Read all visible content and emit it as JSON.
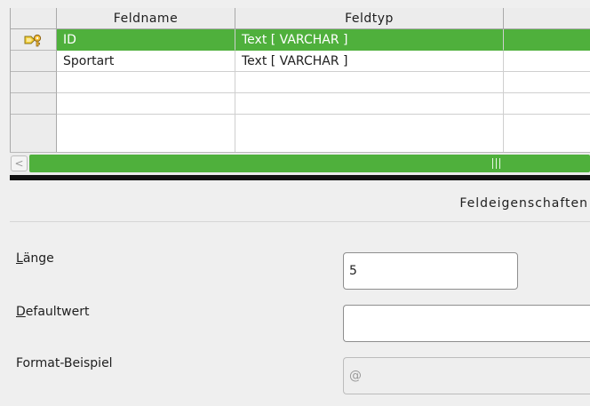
{
  "table": {
    "headers": [
      "",
      "Feldname",
      "Feldtyp",
      ""
    ],
    "rows": [
      {
        "name": "ID",
        "type": "Text [ VARCHAR ]",
        "primary_key": true,
        "selected": true
      },
      {
        "name": "Sportart",
        "type": "Text [ VARCHAR ]",
        "primary_key": false,
        "selected": false
      },
      {
        "name": "",
        "type": "",
        "primary_key": false,
        "selected": false
      },
      {
        "name": "",
        "type": "",
        "primary_key": false,
        "selected": false
      }
    ],
    "row_indicator_icon": "primary-key-icon"
  },
  "scrollbar": {
    "left_arrow": "<",
    "thumb_grip": "grip-lines"
  },
  "properties": {
    "title": "Feldeigenschaften",
    "length": {
      "label_mnemonic": "L",
      "label_rest": "änge",
      "value": "5"
    },
    "default_value": {
      "label_mnemonic": "D",
      "label_rest": "efaultwert",
      "value": ""
    },
    "format_example": {
      "label": "Format-Beispiel",
      "value": "@"
    }
  },
  "colors": {
    "selection": "#4fb03c",
    "scroll_thumb": "#4fb03c",
    "background": "#efefef",
    "header_bg": "#ececec"
  }
}
